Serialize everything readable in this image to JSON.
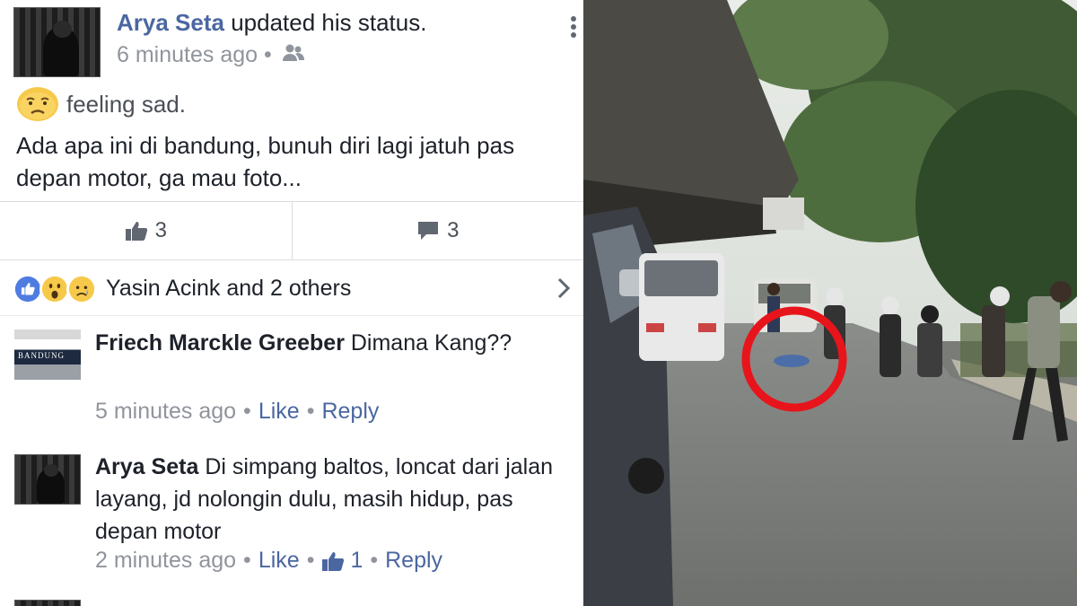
{
  "post": {
    "author": "Arya Seta",
    "action": "updated his status.",
    "time": "6 minutes ago",
    "feeling": "feeling sad.",
    "text": "Ada apa ini di bandung, bunuh diri lagi jatuh pas depan motor, ga mau foto...",
    "like_count": "3",
    "comment_count": "3"
  },
  "reactions": {
    "text": "Yasin Acink and 2 others",
    "icons": [
      "like-reaction-icon",
      "wow-reaction-icon",
      "sad-reaction-icon"
    ]
  },
  "comments": [
    {
      "author": "Friech Marckle Greeber",
      "text": "Dimana Kang??",
      "time": "5 minutes ago",
      "like_label": "Like",
      "reply_label": "Reply"
    },
    {
      "author": "Arya Seta",
      "text": "Di simpang baltos, loncat dari jalan layang, jd nolongin dulu, masih hidup, pas depan motor",
      "time": "2 minutes ago",
      "like_label": "Like",
      "like_count": "1",
      "reply_label": "Reply"
    }
  ],
  "colors": {
    "link_blue": "#4b67a1",
    "meta_gray": "#90949c",
    "highlight_circle": "#e8141b"
  }
}
